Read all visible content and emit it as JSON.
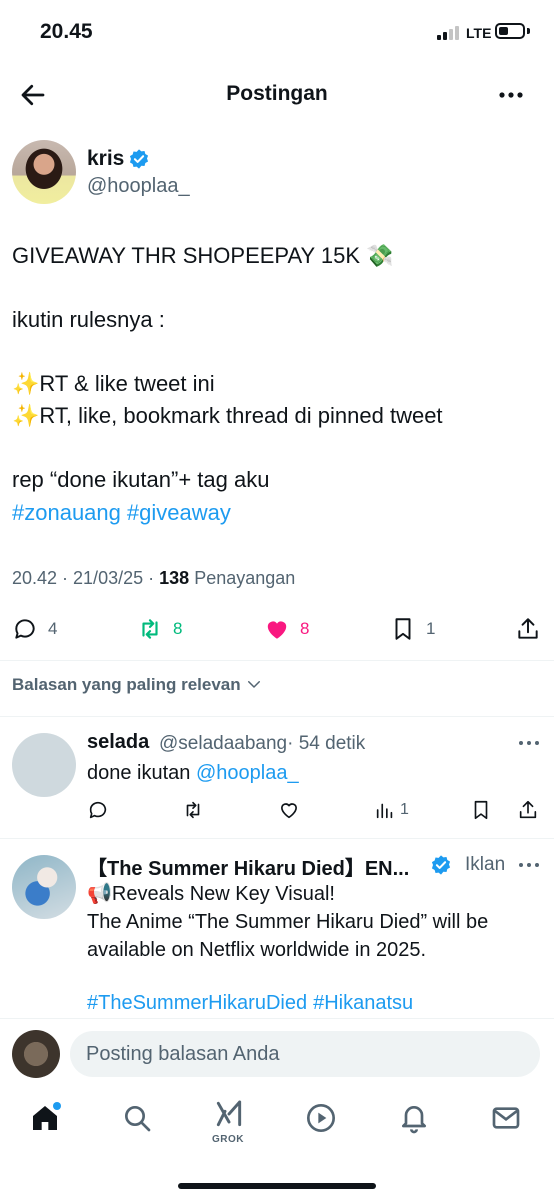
{
  "status_bar": {
    "time": "20.45",
    "network": "LTE",
    "battery_level": 0.3
  },
  "header": {
    "title": "Postingan",
    "back_icon": "arrow-left-icon",
    "more_icon": "more-horizontal-icon"
  },
  "tweet": {
    "author_name": "kris",
    "handle": "@hooplaa_",
    "text": "GIVEAWAY THR SHOPEEPAY 15K 💸\n\nikutin rulesnya :\n\n✨RT & like tweet ini\n✨RT, like, bookmark thread di pinned tweet\n\nrep “done ikutan”+ tag aku",
    "hashtags": [
      "#zonauang",
      "#giveaway"
    ],
    "timestamp": "20.42 · 21/03/25 ·",
    "views_count": "138",
    "views_label": "Penayangan",
    "counts": {
      "replies": "4",
      "retweets": "8",
      "likes": "8",
      "bookmarks": "1"
    },
    "colors": {
      "retweet": "#00ba7c",
      "like": "#f91880",
      "link": "#1d9bf0"
    }
  },
  "sort": {
    "label": "Balasan yang paling relevan"
  },
  "reply": {
    "name": "selada",
    "handle": "@seladaabang",
    "time": "· 54 detik",
    "text": "done ikutan ",
    "mention": "@hooplaa_",
    "views": "1"
  },
  "ad": {
    "name": "【The Summer Hikaru Died】EN...",
    "label": "Iklan",
    "text": "📢Reveals New Key Visual!\nThe Anime “The Summer Hikaru Died” will be available on Netflix worldwide in 2025.",
    "hashtags": [
      "#TheSummerHikaruDied",
      "#Hikanatsu"
    ]
  },
  "compose": {
    "placeholder": "Posting balasan Anda"
  },
  "tabbar": {
    "items": [
      "home-icon",
      "search-icon",
      "grok-icon",
      "video-icon",
      "notifications-icon",
      "messages-icon"
    ],
    "grok_label": "GROK"
  }
}
